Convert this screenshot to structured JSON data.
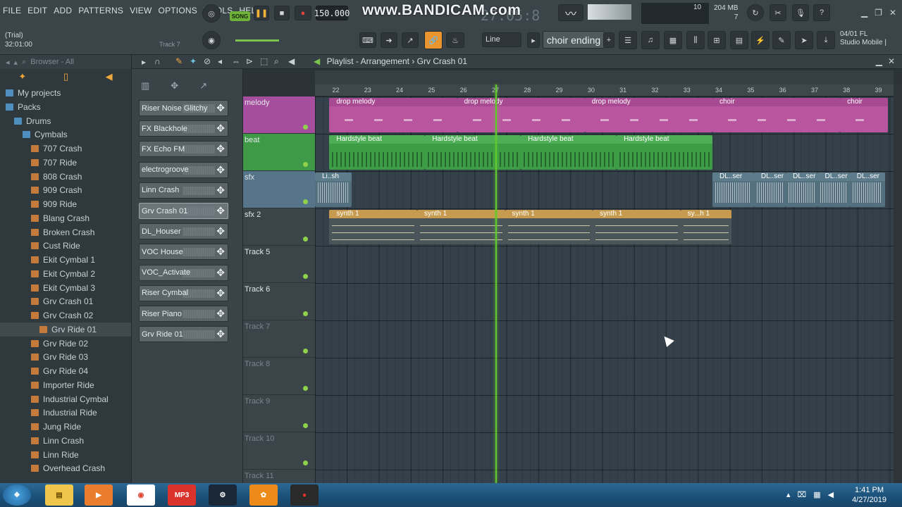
{
  "menu": [
    "FILE",
    "EDIT",
    "ADD",
    "PATTERNS",
    "VIEW",
    "OPTIONS",
    "TOOLS",
    "HELP"
  ],
  "transport": {
    "song_label": "SONG",
    "tempo": "150.000",
    "time": "27:05:8"
  },
  "watermark": "www.BANDICAM.com",
  "trial": {
    "line1": "(Trial)",
    "line2": "32:01:00"
  },
  "hint": "Track 7",
  "memory": {
    "value": "204 MB",
    "cpu": "10",
    "polyphony": "7"
  },
  "snap_mode": "Line",
  "current_pattern": "choir ending",
  "fl_info": {
    "line1": "04/01  FL",
    "line2": "Studio Mobile |"
  },
  "browser": {
    "title": "Browser - All",
    "items": [
      {
        "label": "My projects",
        "type": "folder",
        "indent": 1
      },
      {
        "label": "Packs",
        "type": "folder",
        "indent": 1
      },
      {
        "label": "Drums",
        "type": "folder",
        "indent": 2
      },
      {
        "label": "Cymbals",
        "type": "folder",
        "indent": 3
      },
      {
        "label": "707 Crash",
        "type": "file",
        "indent": 4
      },
      {
        "label": "707 Ride",
        "type": "file",
        "indent": 4
      },
      {
        "label": "808 Crash",
        "type": "file",
        "indent": 4
      },
      {
        "label": "909 Crash",
        "type": "file",
        "indent": 4
      },
      {
        "label": "909 Ride",
        "type": "file",
        "indent": 4
      },
      {
        "label": "Blang Crash",
        "type": "file",
        "indent": 4
      },
      {
        "label": "Broken Crash",
        "type": "file",
        "indent": 4
      },
      {
        "label": "Cust Ride",
        "type": "file",
        "indent": 4
      },
      {
        "label": "Ekit Cymbal 1",
        "type": "file",
        "indent": 4
      },
      {
        "label": "Ekit Cymbal 2",
        "type": "file",
        "indent": 4
      },
      {
        "label": "Ekit Cymbal 3",
        "type": "file",
        "indent": 4
      },
      {
        "label": "Grv Crash 01",
        "type": "file",
        "indent": 4
      },
      {
        "label": "Grv Crash 02",
        "type": "file",
        "indent": 4
      },
      {
        "label": "Grv Ride 01",
        "type": "file",
        "indent": 5,
        "selected": true
      },
      {
        "label": "Grv Ride 02",
        "type": "file",
        "indent": 4
      },
      {
        "label": "Grv Ride 03",
        "type": "file",
        "indent": 4
      },
      {
        "label": "Grv Ride 04",
        "type": "file",
        "indent": 4
      },
      {
        "label": "Importer Ride",
        "type": "file",
        "indent": 4
      },
      {
        "label": "Industrial Cymbal",
        "type": "file",
        "indent": 4
      },
      {
        "label": "Industrial Ride",
        "type": "file",
        "indent": 4
      },
      {
        "label": "Jung Ride",
        "type": "file",
        "indent": 4
      },
      {
        "label": "Linn Crash",
        "type": "file",
        "indent": 4
      },
      {
        "label": "Linn Ride",
        "type": "file",
        "indent": 4
      },
      {
        "label": "Overhead Crash",
        "type": "file",
        "indent": 4
      }
    ]
  },
  "channels": [
    {
      "label": "Riser Noise Glitchy"
    },
    {
      "label": "FX Blackhole"
    },
    {
      "label": "FX Echo FM"
    },
    {
      "label": "electrogroove"
    },
    {
      "label": "Linn Crash"
    },
    {
      "label": "Grv Crash 01",
      "selected": true
    },
    {
      "label": "DL_Houser"
    },
    {
      "label": "VOC House"
    },
    {
      "label": "VOC_Activate"
    },
    {
      "label": "Riser Cymbal"
    },
    {
      "label": "Riser Piano"
    },
    {
      "label": "Grv Ride 01"
    }
  ],
  "playlist": {
    "title": "Playlist - Arrangement",
    "sep": "›",
    "channel": "Grv Crash 01",
    "bars": [
      22,
      23,
      24,
      25,
      26,
      27,
      28,
      29,
      30,
      31,
      32,
      33,
      34,
      35,
      36,
      37,
      38,
      39
    ],
    "playhead_bar": 27,
    "tracks": [
      {
        "label": "melody",
        "style": "t-melody"
      },
      {
        "label": "beat",
        "style": "t-beat"
      },
      {
        "label": "sfx",
        "style": "t-sfx"
      },
      {
        "label": "sfx 2",
        "style": ""
      },
      {
        "label": "Track 5",
        "style": ""
      },
      {
        "label": "Track 6",
        "style": ""
      },
      {
        "label": "Track 7",
        "style": "dim"
      },
      {
        "label": "Track 8",
        "style": "dim"
      },
      {
        "label": "Track 9",
        "style": "dim"
      },
      {
        "label": "Track 10",
        "style": "dim"
      },
      {
        "label": "Track 11",
        "style": "dim"
      }
    ],
    "clips": [
      {
        "track": 0,
        "start": 21.8,
        "len": 4.0,
        "label": "drop melody",
        "kind": "melody"
      },
      {
        "track": 0,
        "start": 25.8,
        "len": 4.0,
        "label": "drop melody",
        "kind": "melody"
      },
      {
        "track": 0,
        "start": 29.8,
        "len": 4.0,
        "label": "drop melody",
        "kind": "melody"
      },
      {
        "track": 0,
        "start": 33.8,
        "len": 4.0,
        "label": "choir",
        "kind": "melody"
      },
      {
        "track": 0,
        "start": 37.8,
        "len": 1.5,
        "label": "choir",
        "kind": "melody"
      },
      {
        "track": 1,
        "start": 21.8,
        "len": 3.0,
        "label": "Hardstyle beat",
        "kind": "beat"
      },
      {
        "track": 1,
        "start": 24.8,
        "len": 3.0,
        "label": "Hardstyle beat",
        "kind": "beat"
      },
      {
        "track": 1,
        "start": 27.8,
        "len": 3.0,
        "label": "Hardstyle beat",
        "kind": "beat"
      },
      {
        "track": 1,
        "start": 30.8,
        "len": 3.0,
        "label": "Hardstyle beat",
        "kind": "beat"
      },
      {
        "track": 2,
        "start": 21.2,
        "len": 1.3,
        "label": "Li..sh",
        "kind": "sfxc"
      },
      {
        "track": 2,
        "start": 33.8,
        "len": 1.3,
        "label": "DL..ser",
        "kind": "sfxc"
      },
      {
        "track": 2,
        "start": 35.1,
        "len": 1.0,
        "label": "DL..ser",
        "kind": "sfxc"
      },
      {
        "track": 2,
        "start": 36.1,
        "len": 1.0,
        "label": "DL..ser",
        "kind": "sfxc"
      },
      {
        "track": 2,
        "start": 37.1,
        "len": 1.0,
        "label": "DL..ser",
        "kind": "sfxc"
      },
      {
        "track": 2,
        "start": 38.1,
        "len": 1.1,
        "label": "DL..ser",
        "kind": "sfxc"
      },
      {
        "track": 3,
        "start": 21.8,
        "len": 2.75,
        "label": "synth 1",
        "kind": "synth"
      },
      {
        "track": 3,
        "start": 24.55,
        "len": 2.75,
        "label": "synth 1",
        "kind": "synth"
      },
      {
        "track": 3,
        "start": 27.3,
        "len": 2.75,
        "label": "synth 1",
        "kind": "synth"
      },
      {
        "track": 3,
        "start": 30.05,
        "len": 2.75,
        "label": "synth 1",
        "kind": "synth"
      },
      {
        "track": 3,
        "start": 32.8,
        "len": 1.6,
        "label": "sy...h 1",
        "kind": "synth"
      }
    ]
  },
  "taskbar": {
    "time": "1:41 PM",
    "date": "4/27/2019"
  }
}
